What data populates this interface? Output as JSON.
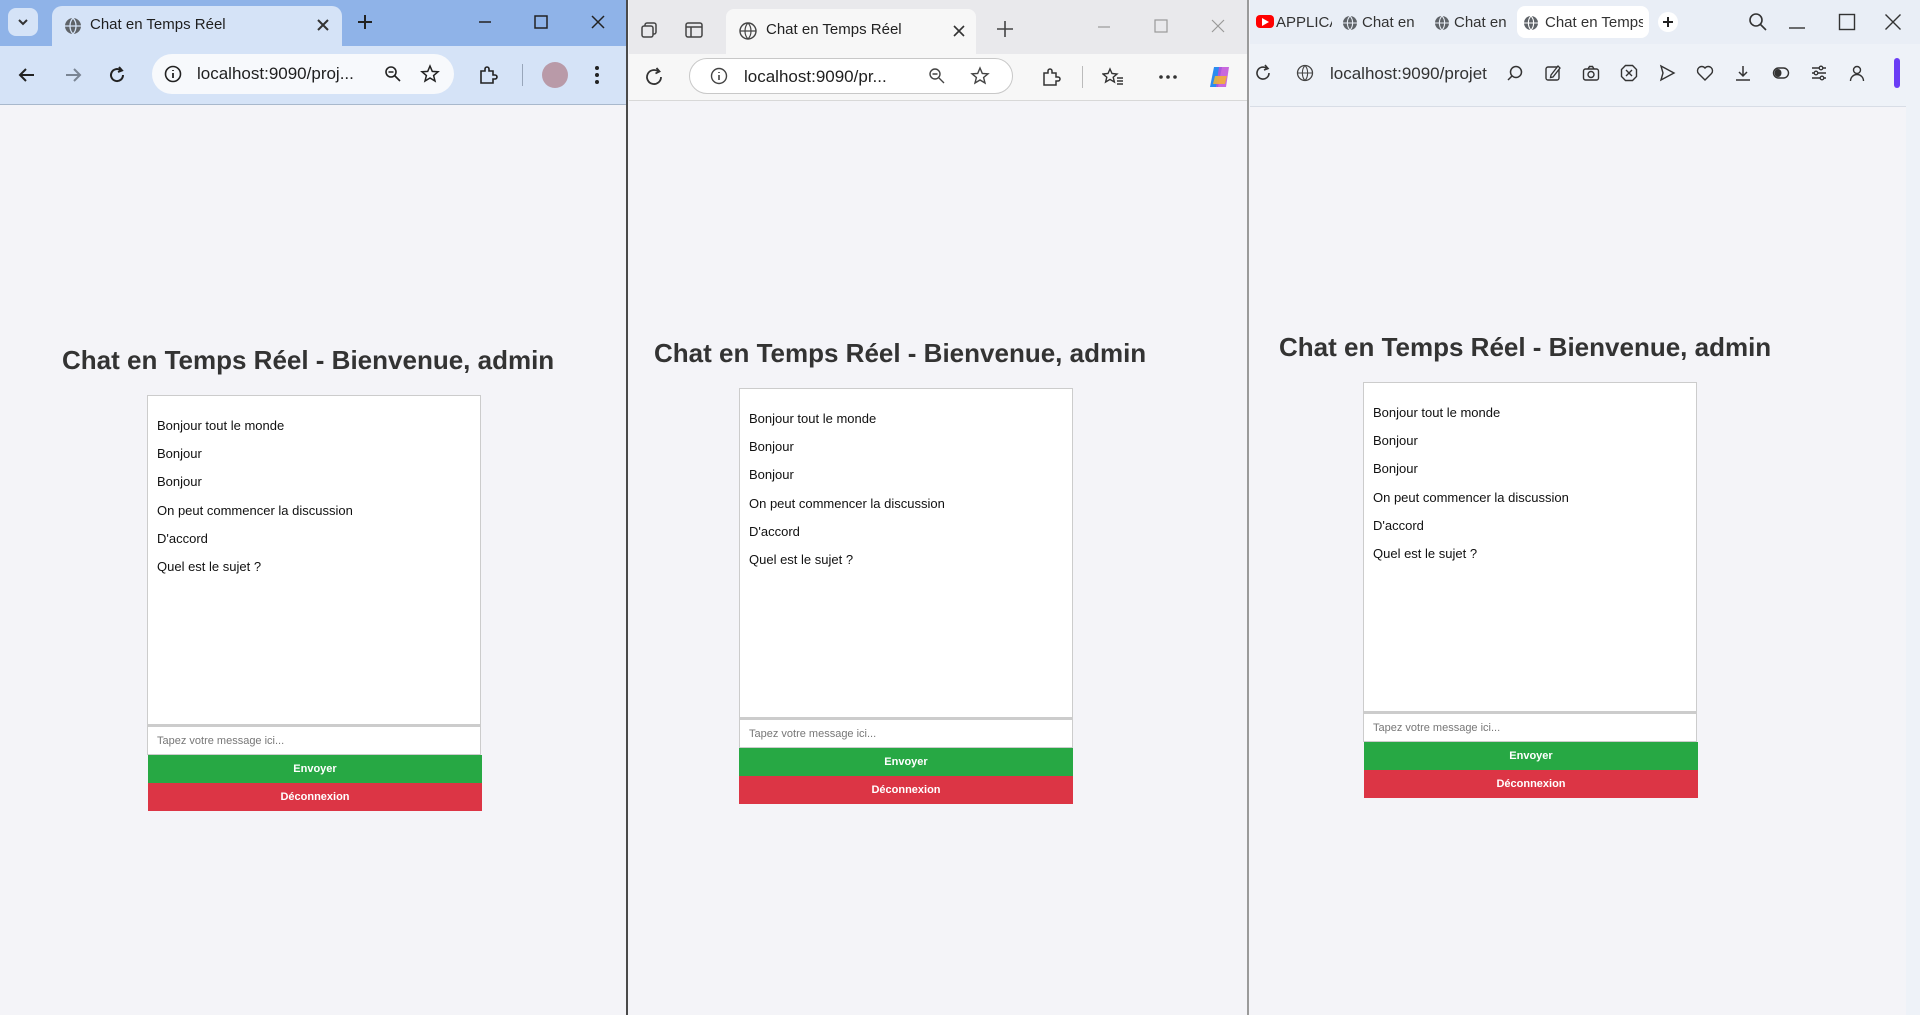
{
  "chat": {
    "title": "Chat en Temps Réel - Bienvenue, admin",
    "messages": [
      "Bonjour tout le monde",
      "Bonjour",
      "Bonjour",
      "On peut commencer la discussion",
      "D'accord",
      "Quel est le sujet ?"
    ],
    "placeholder": "Tapez votre message ici...",
    "send_label": "Envoyer",
    "logout_label": "Déconnexion"
  },
  "chrome": {
    "tab_title": "Chat en Temps Réel",
    "url": "localhost:9090/proj..."
  },
  "edge": {
    "tab_title": "Chat en Temps Réel",
    "url": "localhost:9090/pr..."
  },
  "opera": {
    "tabs": [
      "APPLICA",
      "Chat en",
      "Chat en",
      "Chat en Temps"
    ],
    "url": "localhost:9090/projet"
  },
  "colors": {
    "send": "#27a844",
    "logout": "#dc3545",
    "page_bg": "#f4f4f8"
  }
}
